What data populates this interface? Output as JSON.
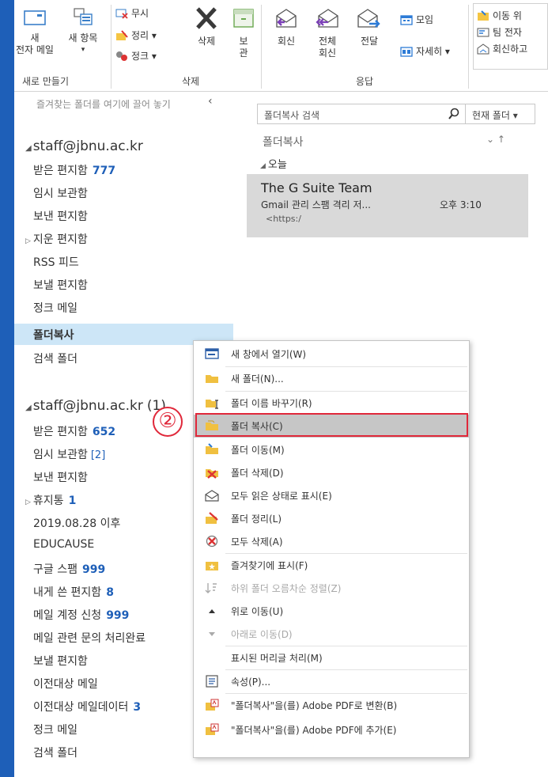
{
  "ribbon": {
    "new_email": {
      "line1": "새",
      "line2": "전자 메일"
    },
    "new_items": {
      "line1": "새 항목",
      "line2": "▾"
    },
    "ignore": "무시",
    "clean_up": "정리 ▾",
    "junk": "정크 ▾",
    "delete": "삭제",
    "archive": {
      "line1": "보",
      "line2": "관"
    },
    "reply": "회신",
    "reply_all": {
      "line1": "전체",
      "line2": "회신"
    },
    "forward": "전달",
    "meeting": "모임",
    "more": "자세히 ▾",
    "move_to": "이동 위",
    "team_email": "팀 전자",
    "reply_delete": "회신하고",
    "group_new": "새로 만들기",
    "group_delete": "삭제",
    "group_respond": "응답"
  },
  "nav": {
    "fav_hint": "즐겨찾는 폴더를 여기에 끌어 놓기",
    "fav_hint_arrow": "‹",
    "account1": {
      "name": "staff@jbnu.ac.kr",
      "folders": [
        {
          "label": "받은 편지함",
          "count": "777"
        },
        {
          "label": "임시 보관함"
        },
        {
          "label": "보낸 편지함"
        },
        {
          "label": "지운 편지함"
        },
        {
          "label": "RSS 피드"
        },
        {
          "label": "보낼 편지함"
        },
        {
          "label": "정크 메일"
        },
        {
          "label": "폴더복사"
        },
        {
          "label": "검색 폴더"
        }
      ]
    },
    "account2": {
      "name": "staff@jbnu.ac.kr",
      "badge": "(1)",
      "folders": [
        {
          "label": "받은 편지함",
          "count": "652"
        },
        {
          "label": "임시 보관함",
          "count": "[2]"
        },
        {
          "label": "보낸 편지함"
        },
        {
          "label": "휴지통",
          "count": "1"
        },
        {
          "label": "2019.08.28 이후"
        },
        {
          "label": "EDUCAUSE"
        },
        {
          "label": "구글 스팸",
          "count": "999"
        },
        {
          "label": "내게 쓴 편지함",
          "count": "8"
        },
        {
          "label": "메일 계정 신청",
          "count": "999"
        },
        {
          "label": "메일 관련 문의 처리완료"
        },
        {
          "label": "보낼 편지함"
        },
        {
          "label": "이전대상 메일"
        },
        {
          "label": "이전대상 메일데이터",
          "count": "3"
        },
        {
          "label": "정크 메일"
        },
        {
          "label": "검색 폴더"
        }
      ]
    }
  },
  "list": {
    "search_placeholder": "폴더복사 검색",
    "scope": "현재 폴더 ▾",
    "folder_title": "폴더복사",
    "sort_glyphs": "⌄   ↑",
    "today": "오늘",
    "message": {
      "from": "The G Suite Team",
      "subject": "Gmail 관리 스팸 격리 저...",
      "time": "오후 3:10",
      "preview": "<https:/"
    }
  },
  "context_menu": {
    "items": [
      {
        "label": "새 창에서 열기(W)",
        "icon": "new-window-icon"
      },
      {
        "label": "새 폴더(N)...",
        "icon": "folder-icon"
      },
      {
        "label": "폴더 이름 바꾸기(R)",
        "icon": "rename-folder-icon"
      },
      {
        "label": "폴더 복사(C)",
        "icon": "copy-folder-icon"
      },
      {
        "label": "폴더 이동(M)",
        "icon": "move-folder-icon"
      },
      {
        "label": "폴더 삭제(D)",
        "icon": "delete-folder-icon"
      },
      {
        "label": "모두 읽은 상태로 표시(E)",
        "icon": "mark-read-icon"
      },
      {
        "label": "폴더 정리(L)",
        "icon": "clean-folder-icon"
      },
      {
        "label": "모두 삭제(A)",
        "icon": "delete-all-icon"
      },
      {
        "label": "즐겨찾기에 표시(F)",
        "icon": "favorite-icon"
      },
      {
        "label": "하위 폴더 오름차순 정렬(Z)",
        "icon": "sort-icon",
        "disabled": true
      },
      {
        "label": "위로 이동(U)",
        "icon": "up-arrow-icon"
      },
      {
        "label": "아래로 이동(D)",
        "icon": "down-arrow-icon",
        "disabled": true
      },
      {
        "label": "표시된 머리글 처리(M)",
        "icon": "none"
      },
      {
        "label": "속성(P)...",
        "icon": "properties-icon"
      },
      {
        "label": "\"폴더복사\"을(를) Adobe PDF로 변환(B)",
        "icon": "pdf-convert-icon"
      },
      {
        "label": "\"폴더복사\"을(를) Adobe PDF에 추가(E)",
        "icon": "pdf-append-icon"
      }
    ],
    "step_marker": "②"
  },
  "colors": {
    "accent_blue": "#1e5fb8",
    "highlight_red": "#e0283a",
    "selection_gray": "#c6c6c6"
  }
}
